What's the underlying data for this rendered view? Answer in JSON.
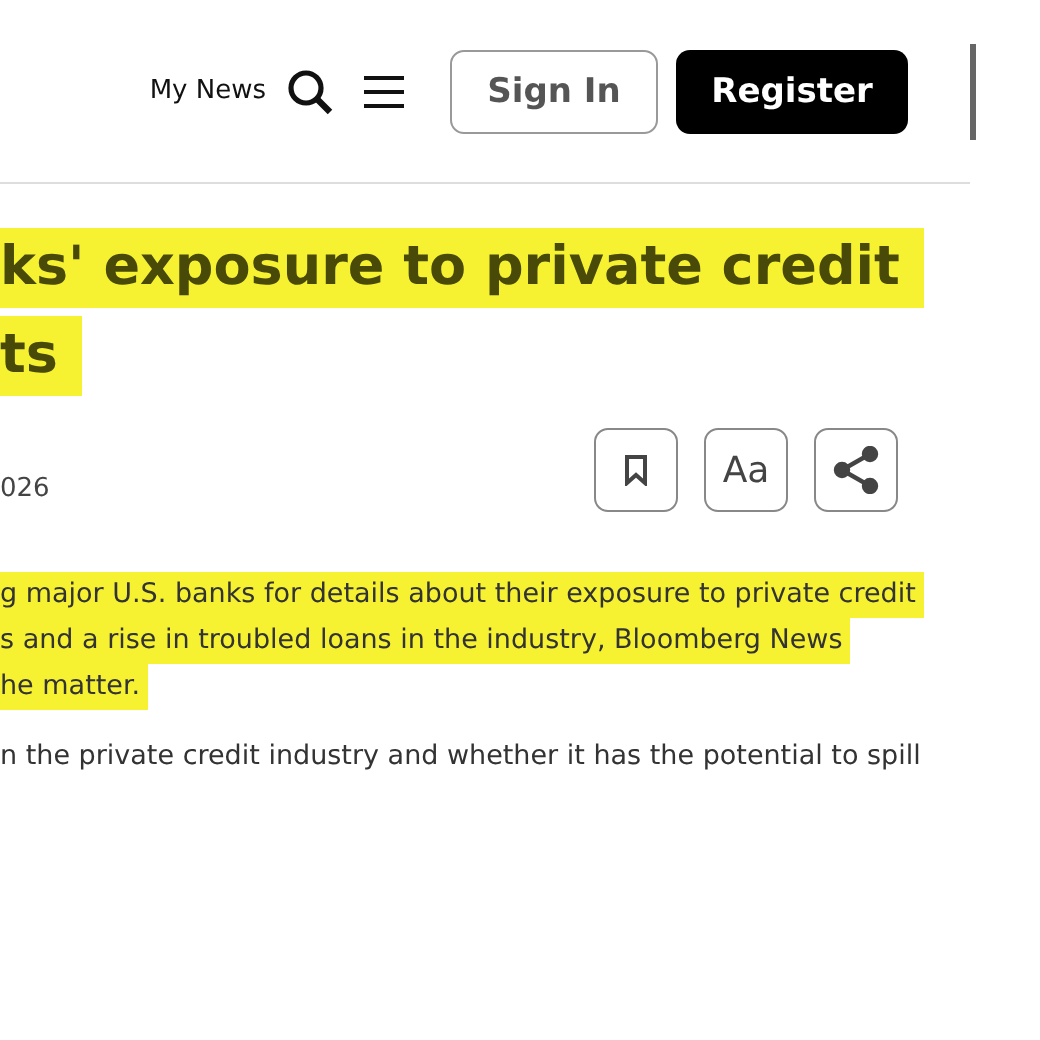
{
  "header": {
    "my_news": "My News",
    "sign_in": "Sign In",
    "register": "Register"
  },
  "headline": [
    {
      "text": "ks' exposure to private credit",
      "highlighted": true
    },
    {
      "text": "ts",
      "highlighted": true
    }
  ],
  "date": "026",
  "tools": [
    {
      "kind": "bookmark"
    },
    {
      "kind": "text-size",
      "label": "Aa"
    },
    {
      "kind": "share"
    }
  ],
  "body": [
    {
      "text": "g major U.S. banks for details about their exposure to private credit",
      "highlighted": true
    },
    {
      "text": "s and a rise in troubled loans in the industry, Bloomberg News",
      "highlighted": true
    },
    {
      "text": "he matter.",
      "highlighted": true
    },
    {
      "text": "n the private credit industry and whether it has the potential to spill",
      "highlighted": false
    }
  ]
}
